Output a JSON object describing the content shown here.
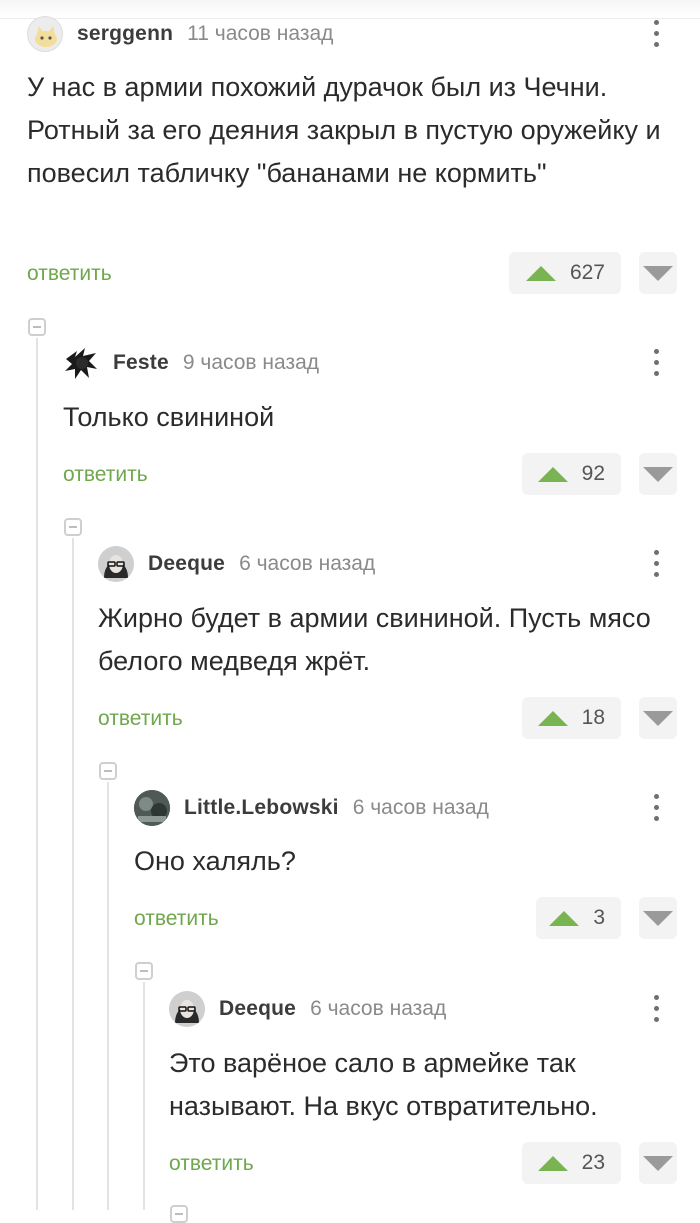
{
  "comments": [
    {
      "author": "serggenn",
      "time": "11 часов назад",
      "text": "У нас в армии похожий дурачок был из Чечни. Ротный за его деяния закрыл в пустую оружейку и повесил табличку \"бананами не кормить\"",
      "reply_label": "ответить",
      "rating": "627",
      "avatar_icon": "cat-avatar-icon"
    },
    {
      "author": "Feste",
      "time": "9 часов назад",
      "text": "Только свининой",
      "reply_label": "ответить",
      "rating": "92",
      "avatar_icon": "jester-silhouette-avatar-icon"
    },
    {
      "author": "Deeque",
      "time": "6 часов назад",
      "text": "Жирно будет в армии свининой. Пусть мясо белого медведя жрёт.",
      "reply_label": "ответить",
      "rating": "18",
      "avatar_icon": "person-with-glasses-avatar-icon"
    },
    {
      "author": "Little.Lebowski",
      "time": "6 часов назад",
      "text": "Оно халяль?",
      "reply_label": "ответить",
      "rating": "3",
      "avatar_icon": "photo-avatar-icon"
    },
    {
      "author": "Deeque",
      "time": "6 часов назад",
      "text": "Это варёное сало в армейке так называют. На вкус отвратительно.",
      "reply_label": "ответить",
      "rating": "23",
      "avatar_icon": "person-with-glasses-avatar-icon"
    }
  ],
  "colors": {
    "accent": "#6fa74d",
    "upvote": "#79b352",
    "downvote": "#9a9a9a",
    "text": "#2b2b2b",
    "meta": "#8a8a8a"
  }
}
